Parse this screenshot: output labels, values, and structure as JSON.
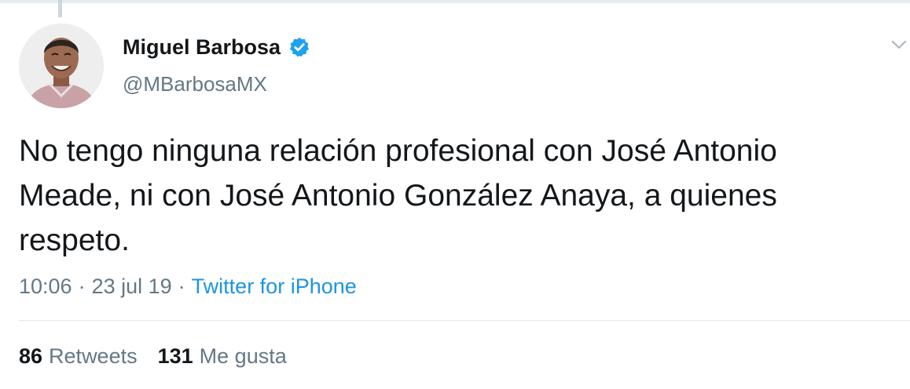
{
  "tweet": {
    "author": {
      "display_name": "Miguel Barbosa",
      "handle": "@MBarbosaMX",
      "verified": true
    },
    "text": "No tengo ninguna relación profesional con José Antonio\nMeade, ni con José Antonio González Anaya, a quienes\nrespeto.",
    "time": "10:06",
    "date": "23 jul 19",
    "separator": "·",
    "source": "Twitter for iPhone",
    "stats": {
      "retweets_count": "86",
      "retweets_label": "Retweets",
      "likes_count": "131",
      "likes_label": "Me gusta"
    }
  },
  "icons": {
    "verified": "verified-badge-icon",
    "caret": "chevron-down-icon"
  },
  "colors": {
    "text": "#14171a",
    "secondary": "#657786",
    "link": "#1b95e0",
    "verified": "#1da1f2",
    "divider": "#e1e8ed"
  }
}
